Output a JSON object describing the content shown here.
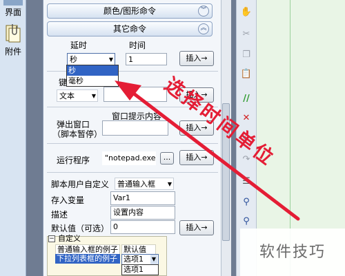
{
  "left_nav": {
    "top_label": "界面",
    "bottom_label": "附件"
  },
  "sections": {
    "color_graphics": "颜色/图形命令",
    "other": "其它命令"
  },
  "delay": {
    "label_delay": "延时",
    "label_time": "时间",
    "unit_value": "秒",
    "time_value": "1",
    "insert": "插入→",
    "unit_options": [
      "秒",
      "毫秒"
    ]
  },
  "key": {
    "label_partial": "键",
    "type_value": "文本",
    "insert": "插入→"
  },
  "popup": {
    "label_line1": "弹出窗口",
    "label_line2": "（脚本暂停）",
    "prompt_label": "窗口提示内容",
    "insert": "插入→"
  },
  "run": {
    "label": "运行程序",
    "path": "\"notepad.exe\"",
    "browse": "...",
    "insert": "插入→"
  },
  "custom": {
    "label": "脚本用户自定义",
    "type_value": "普通输入框",
    "store_label": "存入变量",
    "store_value": "Var1",
    "desc_label": "描述",
    "desc_value": "设置内容",
    "default_label": "默认值（可选）",
    "default_value": "0",
    "insert": "插入→"
  },
  "table": {
    "header": "自定义",
    "row1": {
      "name": "普通输入框的例子",
      "value": "默认值"
    },
    "row2": {
      "name": "下拉列表框的例子",
      "value": "选项1"
    },
    "row3_option": "选项1"
  },
  "annotation": {
    "text": "选择时间单位"
  },
  "watermark": {
    "text": "软件技巧"
  },
  "colors": {
    "annotation": "#e41d35",
    "selection": "#3164c4",
    "editor_bg": "#e9f5e6"
  }
}
